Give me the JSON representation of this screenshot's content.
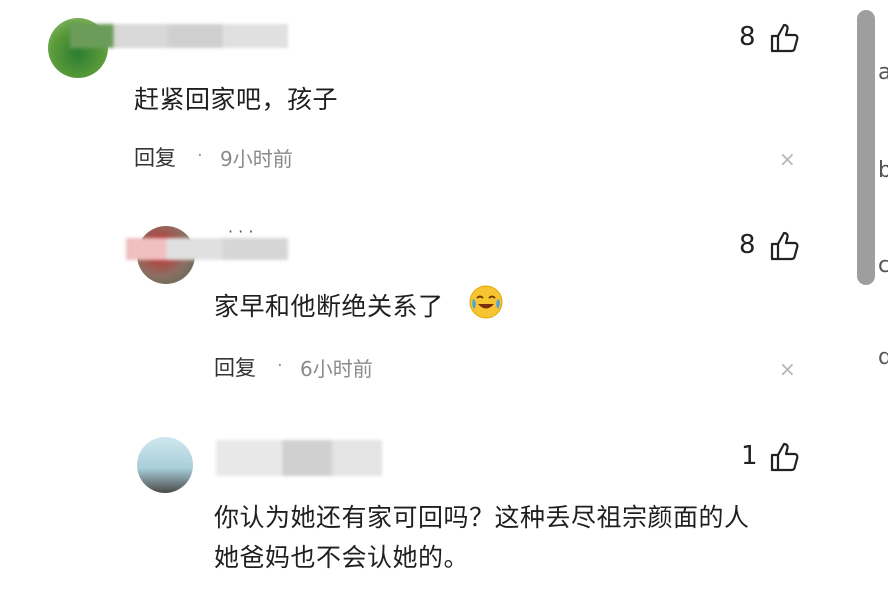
{
  "comments": [
    {
      "likes": "8",
      "text": "赶紧回家吧，孩子",
      "reply_label": "回复",
      "separator": "·",
      "time": "9小时前",
      "close": "×"
    },
    {
      "likes": "8",
      "text": "家早和他断绝关系了",
      "emoji": "crying-laughing-face",
      "reply_label": "回复",
      "separator": "·",
      "time": "6小时前",
      "close": "×",
      "username_dots": "· · ·"
    },
    {
      "likes": "1",
      "text_line1": "你认为她还有家可回吗？这种丢尽祖宗颜面的人",
      "text_line2": "她爸妈也不会认她的。"
    }
  ],
  "edge_glyphs": [
    "a",
    "b",
    "c",
    "d"
  ],
  "colors": {
    "text": "#1f1f1f",
    "meta": "#8a8a8a",
    "scrollbar": "#9e9e9e"
  }
}
